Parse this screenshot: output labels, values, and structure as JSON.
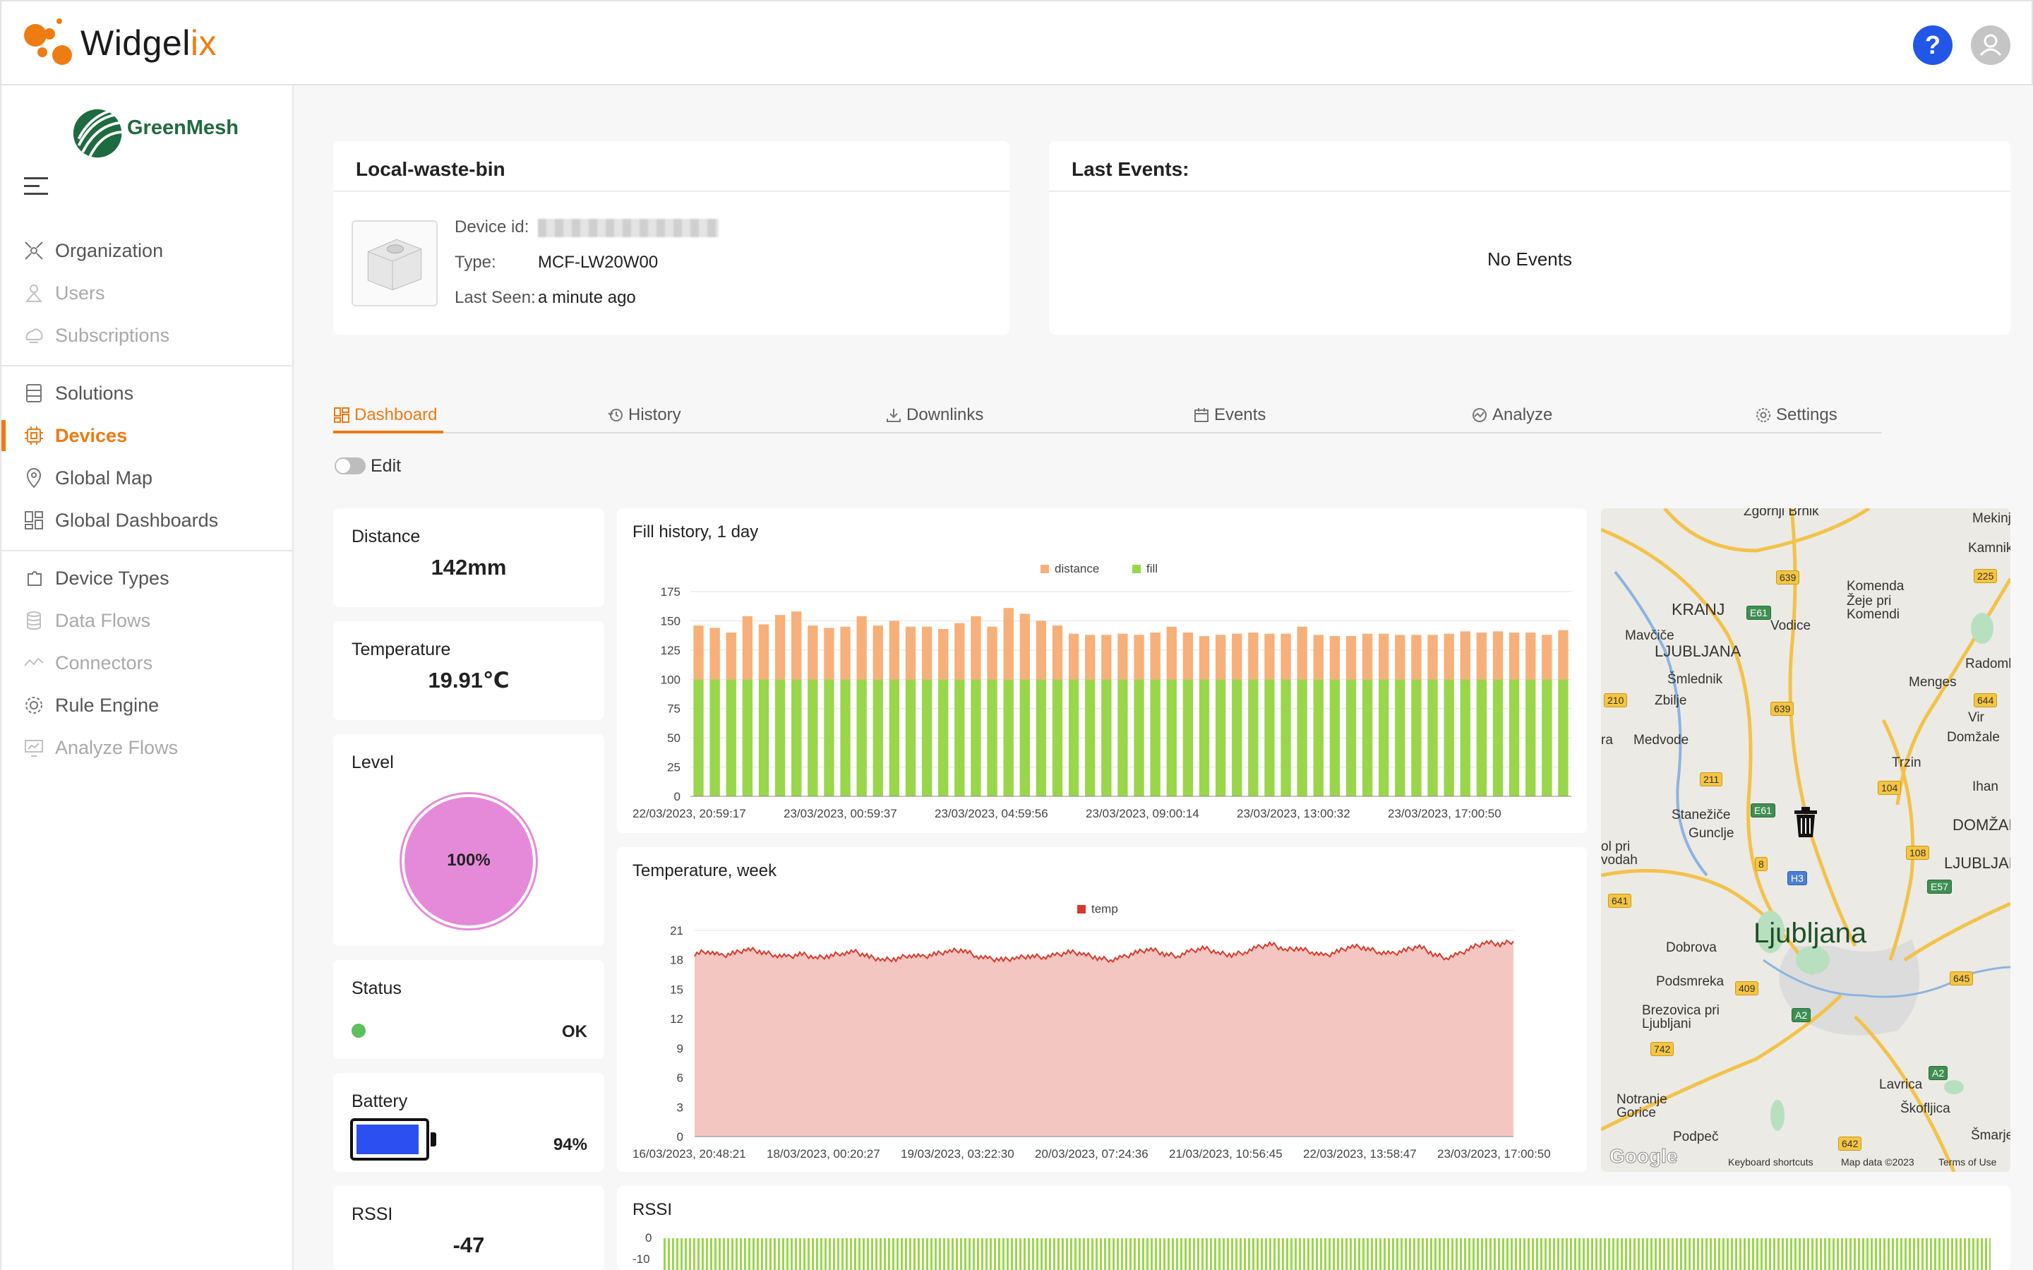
{
  "app": {
    "name_main": "Widgel",
    "name_accent": "ix",
    "help_label": "?"
  },
  "org": {
    "name": "GreenMesh"
  },
  "sidebar": {
    "items": [
      {
        "label": "Organization",
        "icon": "organization-icon",
        "state": "normal"
      },
      {
        "label": "Users",
        "icon": "users-icon",
        "state": "dim"
      },
      {
        "label": "Subscriptions",
        "icon": "subscriptions-icon",
        "state": "dim"
      },
      {
        "label": "Solutions",
        "icon": "solutions-icon",
        "state": "normal"
      },
      {
        "label": "Devices",
        "icon": "devices-icon",
        "state": "active"
      },
      {
        "label": "Global Map",
        "icon": "map-pin-icon",
        "state": "normal"
      },
      {
        "label": "Global Dashboards",
        "icon": "dashboards-icon",
        "state": "normal"
      },
      {
        "label": "Device Types",
        "icon": "device-types-icon",
        "state": "normal"
      },
      {
        "label": "Data Flows",
        "icon": "data-flows-icon",
        "state": "dim"
      },
      {
        "label": "Connectors",
        "icon": "connectors-icon",
        "state": "dim"
      },
      {
        "label": "Rule Engine",
        "icon": "rule-engine-icon",
        "state": "normal"
      },
      {
        "label": "Analyze Flows",
        "icon": "analyze-flows-icon",
        "state": "dim"
      }
    ]
  },
  "device": {
    "name": "Local-waste-bin",
    "id_label": "Device id:",
    "type_label": "Type:",
    "type_value": "MCF-LW20W00",
    "last_seen_label": "Last Seen:",
    "last_seen_value": "a minute ago"
  },
  "events": {
    "title": "Last Events:",
    "empty": "No Events"
  },
  "tabs": [
    {
      "label": "Dashboard",
      "icon": "dashboard-icon",
      "active": true
    },
    {
      "label": "History",
      "icon": "history-icon",
      "active": false
    },
    {
      "label": "Downlinks",
      "icon": "download-icon",
      "active": false
    },
    {
      "label": "Events",
      "icon": "calendar-icon",
      "active": false
    },
    {
      "label": "Analyze",
      "icon": "analyze-icon",
      "active": false
    },
    {
      "label": "Settings",
      "icon": "gear-icon",
      "active": false
    }
  ],
  "edit": {
    "label": "Edit"
  },
  "tiles": {
    "distance": {
      "title": "Distance",
      "value": "142mm"
    },
    "temperature": {
      "title": "Temperature",
      "value": "19.91℃"
    },
    "level": {
      "title": "Level",
      "value": "100%",
      "fraction": 1.0
    },
    "status": {
      "title": "Status",
      "value": "OK",
      "color": "#5cc05c"
    },
    "battery": {
      "title": "Battery",
      "value": "94%",
      "fraction": 0.94,
      "color": "#2b4ff0"
    },
    "rssi": {
      "title": "RSSI",
      "value": "-47"
    }
  },
  "colors": {
    "accent": "#ee7a12",
    "distance": "#f7b07a",
    "fill": "#9ad64a",
    "temp": "#d93a2b",
    "temp_area": "#f3c6c2",
    "level": "#e58ad9"
  },
  "chart_data": [
    {
      "type": "bar",
      "title": "Fill history, 1 day",
      "stacked": true,
      "ylim": [
        0,
        175
      ],
      "yticks": [
        "0",
        "25",
        "50",
        "75",
        "100",
        "125",
        "150",
        "175"
      ],
      "xticks": [
        "22/03/2023, 20:59:17",
        "23/03/2023, 00:59:37",
        "23/03/2023, 04:59:56",
        "23/03/2023, 09:00:14",
        "23/03/2023, 13:00:32",
        "23/03/2023, 17:00:50"
      ],
      "legend": "top-center",
      "series": [
        {
          "name": "distance",
          "values": [
            46,
            44,
            40,
            54,
            47,
            55,
            58,
            46,
            44,
            45,
            54,
            46,
            50,
            45,
            45,
            43,
            48,
            54,
            45,
            61,
            56,
            50,
            46,
            39,
            38,
            38,
            39,
            38,
            40,
            45,
            40,
            37,
            38,
            39,
            40,
            39,
            39,
            45,
            38,
            37,
            37,
            39,
            39,
            38,
            38,
            38,
            39,
            41,
            40,
            41,
            40,
            40,
            38,
            42
          ]
        },
        {
          "name": "fill",
          "values": [
            100,
            100,
            100,
            100,
            100,
            100,
            100,
            100,
            100,
            100,
            100,
            100,
            100,
            100,
            100,
            100,
            100,
            100,
            100,
            100,
            100,
            100,
            100,
            100,
            100,
            100,
            100,
            100,
            100,
            100,
            100,
            100,
            100,
            100,
            100,
            100,
            100,
            100,
            100,
            100,
            100,
            100,
            100,
            100,
            100,
            100,
            100,
            100,
            100,
            100,
            100,
            100,
            100,
            100
          ]
        }
      ]
    },
    {
      "type": "area",
      "title": "Temperature, week",
      "ylim": [
        0,
        21
      ],
      "yticks": [
        "0",
        "3",
        "6",
        "9",
        "12",
        "15",
        "18",
        "21"
      ],
      "xticks": [
        "16/03/2023, 20:48:21",
        "18/03/2023, 00:20:27",
        "19/03/2023, 03:22:30",
        "20/03/2023, 07:24:36",
        "21/03/2023, 10:56:45",
        "22/03/2023, 13:58:47",
        "23/03/2023, 17:00:50"
      ],
      "legend": "top-center",
      "series": [
        {
          "name": "temp",
          "values": [
            18.6,
            18.9,
            18.4,
            18.7,
            19.1,
            18.8,
            18.5,
            18.3,
            18.6,
            18.2,
            18.4,
            18.7,
            18.8,
            18.3,
            18.0,
            18.1,
            18.5,
            18.3,
            18.6,
            18.9,
            19.0,
            18.4,
            18.1,
            18.0,
            18.2,
            18.4,
            18.3,
            18.5,
            18.8,
            18.6,
            18.2,
            18.0,
            18.3,
            18.8,
            19.1,
            18.6,
            18.4,
            18.9,
            19.2,
            18.7,
            18.5,
            18.8,
            19.3,
            19.6,
            19.0,
            19.2,
            18.8,
            18.4,
            18.9,
            19.4,
            19.2,
            18.8,
            18.6,
            19.0,
            19.4,
            18.6,
            18.2,
            18.6,
            19.3,
            19.8,
            19.6,
            19.9
          ]
        }
      ]
    },
    {
      "type": "bar",
      "title": "RSSI",
      "yticks": [
        "0",
        "-10"
      ],
      "series": [
        {
          "name": "rssi",
          "values": []
        }
      ]
    }
  ],
  "map": {
    "places": [
      "Zgornji Brnik",
      "Mekinj",
      "Kamnik",
      "Komenda",
      "Žeje pri Komendi",
      "KRANJ",
      "Vodice",
      "Mavčiče",
      "LJUBLJANA",
      "Šmlednik",
      "Zbilje",
      "Menges",
      "Radomlj",
      "Vir",
      "Domžale",
      "Medvode",
      "Trzin",
      "Ihan",
      "Stanežiče",
      "Gunclje",
      "DOMŽAL",
      "LJUBLJAN",
      "Ljubljana",
      "Dobrova",
      "Podsmreka",
      "Brezovica pri Ljubljani",
      "Lavrica",
      "Notranje Gorice",
      "Škofljica",
      "Podpeč",
      "Šmarje",
      "ol pri vodah",
      "ra"
    ],
    "roads": [
      "639",
      "E61",
      "225",
      "210",
      "639",
      "211",
      "644",
      "104",
      "E61",
      "108",
      "E57",
      "H3",
      "641",
      "409",
      "A2",
      "645",
      "742",
      "A2",
      "642",
      "8"
    ],
    "credits": [
      "Keyboard shortcuts",
      "Map data ©2023",
      "Terms of Use"
    ],
    "brand": "Google"
  }
}
